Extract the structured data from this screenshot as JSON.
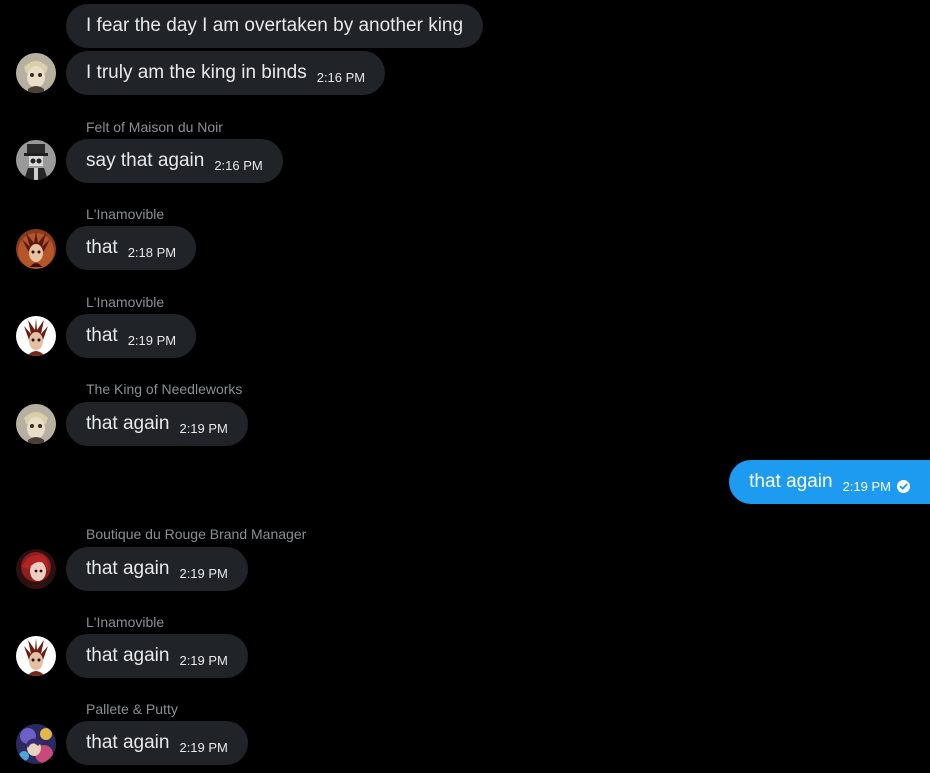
{
  "colors": {
    "background": "#000000",
    "incoming_bubble": "#202327",
    "outgoing_bubble": "#1d9bf0",
    "sender_name": "#8b8f94"
  },
  "messages": [
    {
      "sender": "",
      "text": "I fear the day I am overtaken by another king",
      "time": ""
    },
    {
      "sender": "",
      "text": "I truly am the king in binds",
      "time": "2:16 PM",
      "avatar": "king-avatar"
    },
    {
      "sender": "Felt of Maison du Noir",
      "text": "say that again",
      "time": "2:16 PM",
      "avatar": "felt-avatar"
    },
    {
      "sender": "L'Inamovible",
      "text": "that",
      "time": "2:18 PM",
      "avatar": "inamovible-avatar-orange"
    },
    {
      "sender": "L'Inamovible",
      "text": "that",
      "time": "2:19 PM",
      "avatar": "inamovible-avatar-white"
    },
    {
      "sender": "The King of Needleworks",
      "text": "that again",
      "time": "2:19 PM",
      "avatar": "king-avatar"
    },
    {
      "sender": "",
      "text": "that again",
      "time": "2:19 PM",
      "outgoing": true,
      "status_icon": "check-circle-icon"
    },
    {
      "sender": "Boutique du Rouge Brand Manager",
      "text": "that again",
      "time": "2:19 PM",
      "avatar": "rouge-avatar"
    },
    {
      "sender": "L'Inamovible",
      "text": "that again",
      "time": "2:19 PM",
      "avatar": "inamovible-avatar-white"
    },
    {
      "sender": "Pallete & Putty",
      "text": "that again",
      "time": "2:19 PM",
      "avatar": "pallete-avatar"
    }
  ]
}
